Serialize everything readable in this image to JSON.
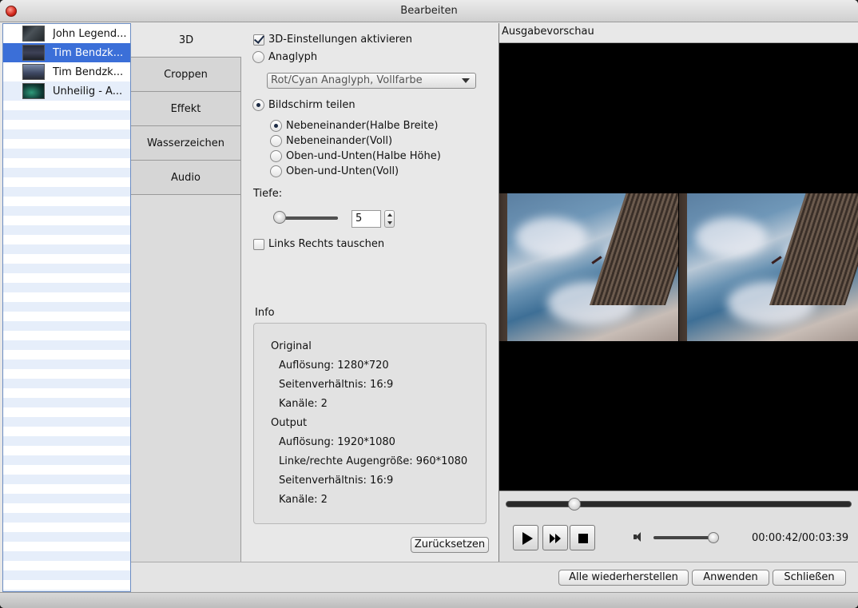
{
  "window": {
    "title": "Bearbeiten"
  },
  "files": [
    {
      "name": "John Legend..."
    },
    {
      "name": "Tim Bendzk..."
    },
    {
      "name": "Tim Bendzk..."
    },
    {
      "name": "Unheilig - A..."
    }
  ],
  "tabs": [
    "3D",
    "Croppen",
    "Effekt",
    "Wasserzeichen",
    "Audio"
  ],
  "settings3d": {
    "enable_label": "3D-Einstellungen aktivieren",
    "anaglyph_label": "Anaglyph",
    "anaglyph_option": "Rot/Cyan Anaglyph, Vollfarbe",
    "split_label": "Bildschirm teilen",
    "split_options": [
      "Nebeneinander(Halbe Breite)",
      "Nebeneinander(Voll)",
      "Oben-und-Unten(Halbe Höhe)",
      "Oben-und-Unten(Voll)"
    ],
    "depth_label": "Tiefe:",
    "depth_value": "5",
    "swap_label": "Links Rechts tauschen"
  },
  "info": {
    "title": "Info",
    "original_heading": "Original",
    "original_resolution": "Auflösung: 1280*720",
    "original_aspect": "Seitenverhältnis: 16:9",
    "original_channels": "Kanäle: 2",
    "output_heading": "Output",
    "output_resolution": "Auflösung: 1920*1080",
    "output_eye_size": "Linke/rechte Augengröße: 960*1080",
    "output_aspect": "Seitenverhältnis: 16:9",
    "output_channels": "Kanäle: 2"
  },
  "buttons": {
    "reset": "Zurücksetzen",
    "restore_all": "Alle wiederherstellen",
    "apply": "Anwenden",
    "close": "Schließen"
  },
  "preview": {
    "title": "Ausgabevorschau",
    "time": "00:00:42/00:03:39"
  }
}
